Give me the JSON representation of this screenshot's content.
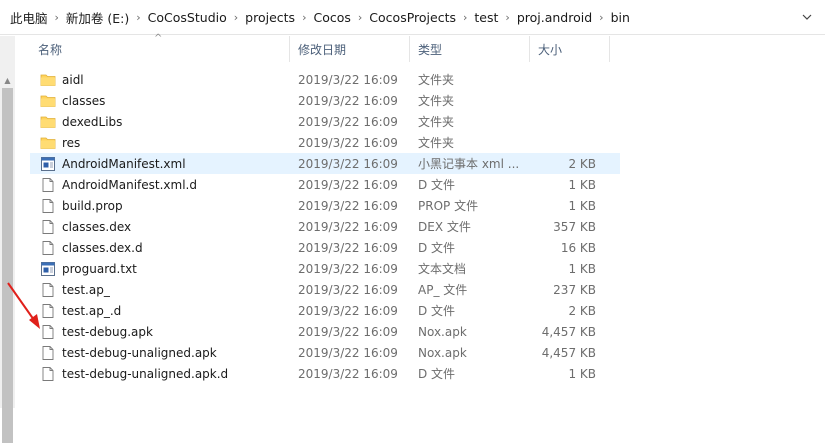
{
  "address": {
    "crumbs": [
      "此电脑",
      "新加卷 (E:)",
      "CoCosStudio",
      "projects",
      "Cocos",
      "CocosProjects",
      "test",
      "proj.android",
      "bin"
    ]
  },
  "columns": {
    "name": "名称",
    "date": "修改日期",
    "type": "类型",
    "size": "大小"
  },
  "files": [
    {
      "name": "aidl",
      "date": "2019/3/22 16:09",
      "type": "文件夹",
      "size": "",
      "icon": "folder-icon"
    },
    {
      "name": "classes",
      "date": "2019/3/22 16:09",
      "type": "文件夹",
      "size": "",
      "icon": "folder-icon"
    },
    {
      "name": "dexedLibs",
      "date": "2019/3/22 16:09",
      "type": "文件夹",
      "size": "",
      "icon": "folder-icon"
    },
    {
      "name": "res",
      "date": "2019/3/22 16:09",
      "type": "文件夹",
      "size": "",
      "icon": "folder-icon"
    },
    {
      "name": "AndroidManifest.xml",
      "date": "2019/3/22 16:09",
      "type": "小黑记事本 xml ...",
      "size": "2 KB",
      "icon": "notepad-file-icon",
      "selected": true
    },
    {
      "name": "AndroidManifest.xml.d",
      "date": "2019/3/22 16:09",
      "type": "D 文件",
      "size": "1 KB",
      "icon": "file-icon"
    },
    {
      "name": "build.prop",
      "date": "2019/3/22 16:09",
      "type": "PROP 文件",
      "size": "1 KB",
      "icon": "file-icon"
    },
    {
      "name": "classes.dex",
      "date": "2019/3/22 16:09",
      "type": "DEX 文件",
      "size": "357 KB",
      "icon": "file-icon"
    },
    {
      "name": "classes.dex.d",
      "date": "2019/3/22 16:09",
      "type": "D 文件",
      "size": "16 KB",
      "icon": "file-icon"
    },
    {
      "name": "proguard.txt",
      "date": "2019/3/22 16:09",
      "type": "文本文档",
      "size": "1 KB",
      "icon": "notepad-file-icon"
    },
    {
      "name": "test.ap_",
      "date": "2019/3/22 16:09",
      "type": "AP_ 文件",
      "size": "237 KB",
      "icon": "file-icon"
    },
    {
      "name": "test.ap_.d",
      "date": "2019/3/22 16:09",
      "type": "D 文件",
      "size": "2 KB",
      "icon": "file-icon"
    },
    {
      "name": "test-debug.apk",
      "date": "2019/3/22 16:09",
      "type": "Nox.apk",
      "size": "4,457 KB",
      "icon": "file-icon"
    },
    {
      "name": "test-debug-unaligned.apk",
      "date": "2019/3/22 16:09",
      "type": "Nox.apk",
      "size": "4,457 KB",
      "icon": "file-icon"
    },
    {
      "name": "test-debug-unaligned.apk.d",
      "date": "2019/3/22 16:09",
      "type": "D 文件",
      "size": "1 KB",
      "icon": "file-icon"
    }
  ],
  "colors": {
    "selected_row": "#e5f3ff",
    "folder": "#ffd35c",
    "annotation_arrow": "#e0201b"
  }
}
